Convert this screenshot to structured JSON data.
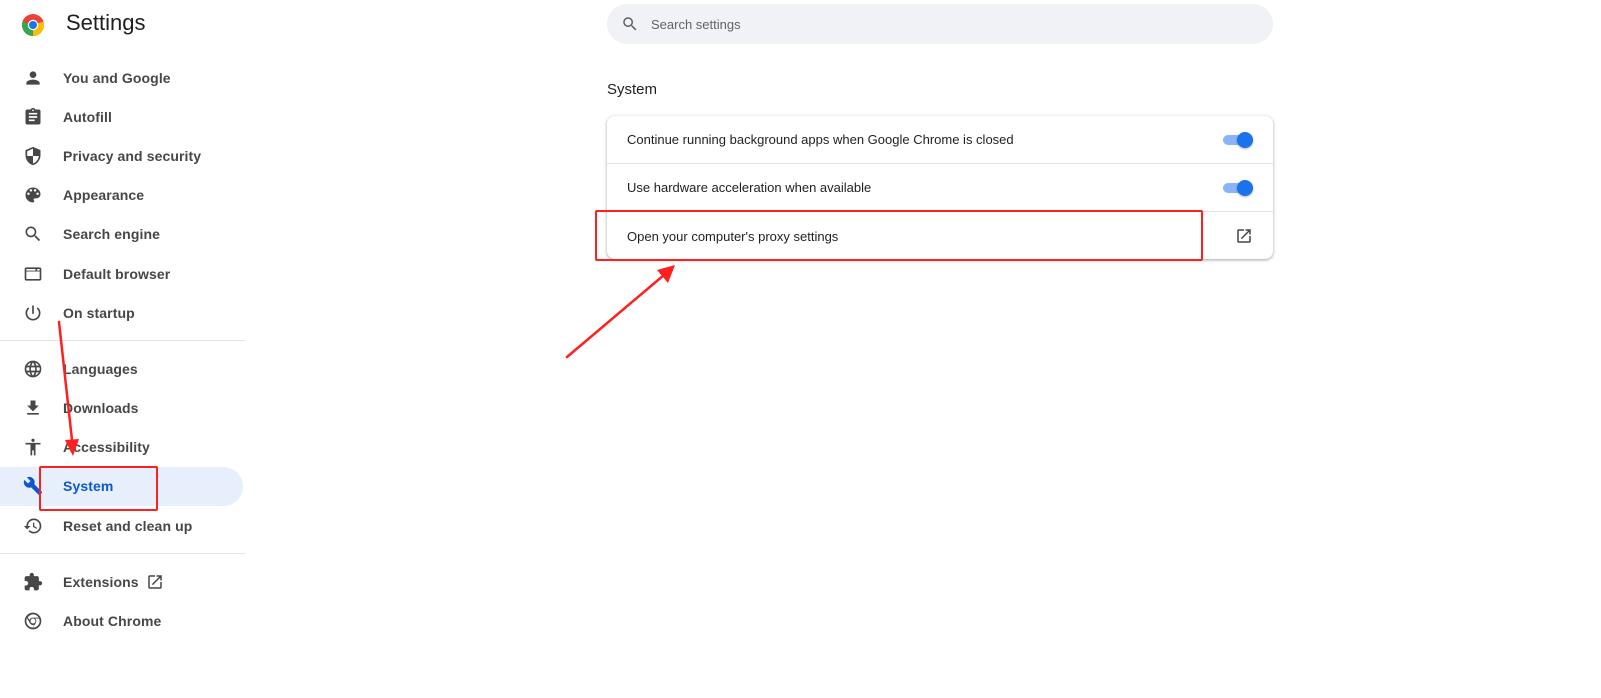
{
  "header": {
    "title": "Settings",
    "logo_icon": "chrome-logo-icon"
  },
  "search": {
    "placeholder": "Search settings",
    "value": ""
  },
  "sidebar": {
    "groups": [
      [
        {
          "label": "You and Google",
          "icon": "person-icon"
        },
        {
          "label": "Autofill",
          "icon": "clipboard-icon"
        },
        {
          "label": "Privacy and security",
          "icon": "shield-icon"
        },
        {
          "label": "Appearance",
          "icon": "palette-icon"
        },
        {
          "label": "Search engine",
          "icon": "search-icon"
        },
        {
          "label": "Default browser",
          "icon": "browser-window-icon"
        },
        {
          "label": "On startup",
          "icon": "power-icon"
        }
      ],
      [
        {
          "label": "Languages",
          "icon": "globe-icon"
        },
        {
          "label": "Downloads",
          "icon": "download-icon"
        },
        {
          "label": "Accessibility",
          "icon": "accessibility-icon"
        },
        {
          "label": "System",
          "icon": "wrench-icon",
          "active": true
        },
        {
          "label": "Reset and clean up",
          "icon": "history-icon"
        }
      ],
      [
        {
          "label": "Extensions",
          "icon": "puzzle-icon",
          "external": true
        },
        {
          "label": "About Chrome",
          "icon": "chrome-outline-icon"
        }
      ]
    ]
  },
  "main": {
    "section_title": "System",
    "rows": [
      {
        "label": "Continue running background apps when Google Chrome is closed",
        "control": "toggle",
        "on": true
      },
      {
        "label": "Use hardware acceleration when available",
        "control": "toggle",
        "on": true
      },
      {
        "label": "Open your computer's proxy settings",
        "control": "external-link"
      }
    ]
  },
  "colors": {
    "accent": "#0b57d0",
    "active_bg": "#e8effc",
    "annotation": "#ff1f1f",
    "toggle_track": "#8ab4f8",
    "toggle_knob": "#1a73e8"
  }
}
